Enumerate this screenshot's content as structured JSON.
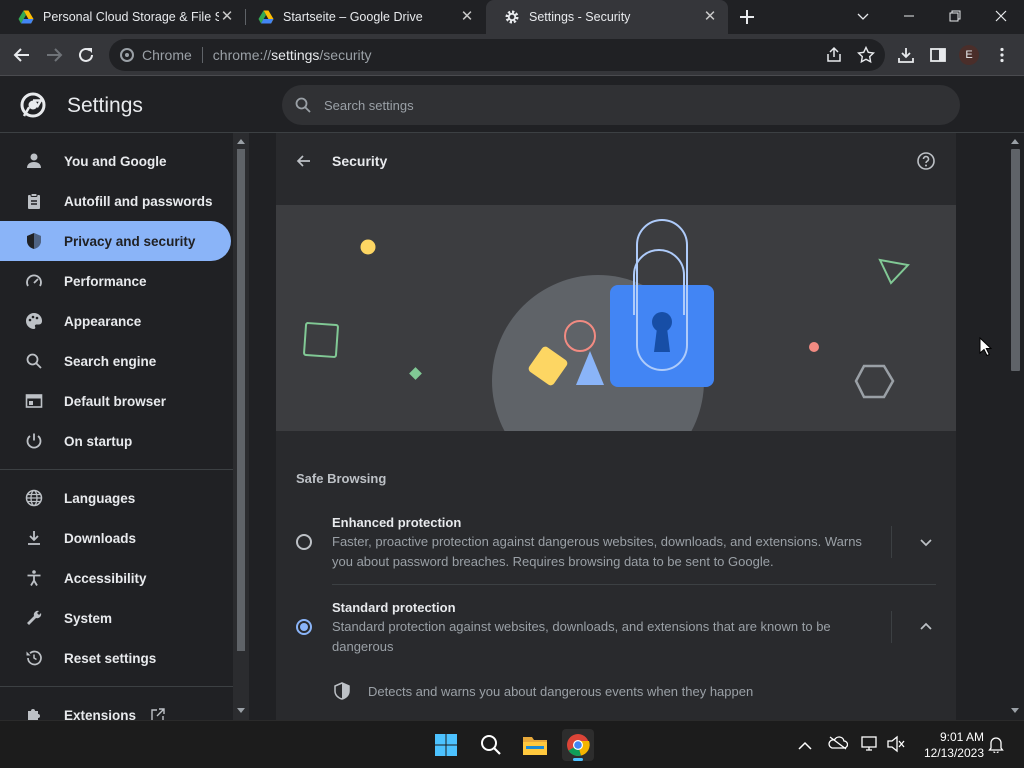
{
  "tabs": [
    {
      "title": "Personal Cloud Storage & File Sh",
      "icon": "google-drive-icon",
      "active": false
    },
    {
      "title": "Startseite – Google Drive",
      "icon": "google-drive-icon",
      "active": false
    },
    {
      "title": "Settings - Security",
      "icon": "gear-icon",
      "active": true
    }
  ],
  "omnibox": {
    "site": "Chrome",
    "url_prefix": "chrome://",
    "url_host": "settings",
    "url_path": "/security"
  },
  "profile_initial": "E",
  "settings": {
    "title": "Settings",
    "search_placeholder": "Search settings"
  },
  "sidebar": {
    "items": [
      {
        "label": "You and Google",
        "icon": "person-icon"
      },
      {
        "label": "Autofill and passwords",
        "icon": "clipboard-icon"
      },
      {
        "label": "Privacy and security",
        "icon": "shield-icon",
        "active": true
      },
      {
        "label": "Performance",
        "icon": "speedometer-icon"
      },
      {
        "label": "Appearance",
        "icon": "palette-icon"
      },
      {
        "label": "Search engine",
        "icon": "search-icon"
      },
      {
        "label": "Default browser",
        "icon": "browser-icon"
      },
      {
        "label": "On startup",
        "icon": "power-icon"
      },
      {
        "label": "Languages",
        "icon": "globe-icon"
      },
      {
        "label": "Downloads",
        "icon": "download-icon"
      },
      {
        "label": "Accessibility",
        "icon": "accessibility-icon"
      },
      {
        "label": "System",
        "icon": "wrench-icon"
      },
      {
        "label": "Reset settings",
        "icon": "restore-icon"
      },
      {
        "label": "Extensions",
        "icon": "puzzle-icon"
      }
    ]
  },
  "page": {
    "title": "Security",
    "section": "Safe Browsing",
    "options": [
      {
        "title": "Enhanced protection",
        "desc": "Faster, proactive protection against dangerous websites, downloads, and extensions. Warns you about password breaches. Requires browsing data to be sent to Google.",
        "selected": false,
        "expanded": false
      },
      {
        "title": "Standard protection",
        "desc": "Standard protection against websites, downloads, and extensions that are known to be dangerous",
        "selected": true,
        "expanded": true
      }
    ],
    "detail": "Detects and warns you about dangerous events when they happen"
  },
  "taskbar": {
    "time": "9:01 AM",
    "date": "12/13/2023"
  },
  "colors": {
    "accent": "#8ab4f8",
    "background": "#202124",
    "card": "#292a2d"
  }
}
